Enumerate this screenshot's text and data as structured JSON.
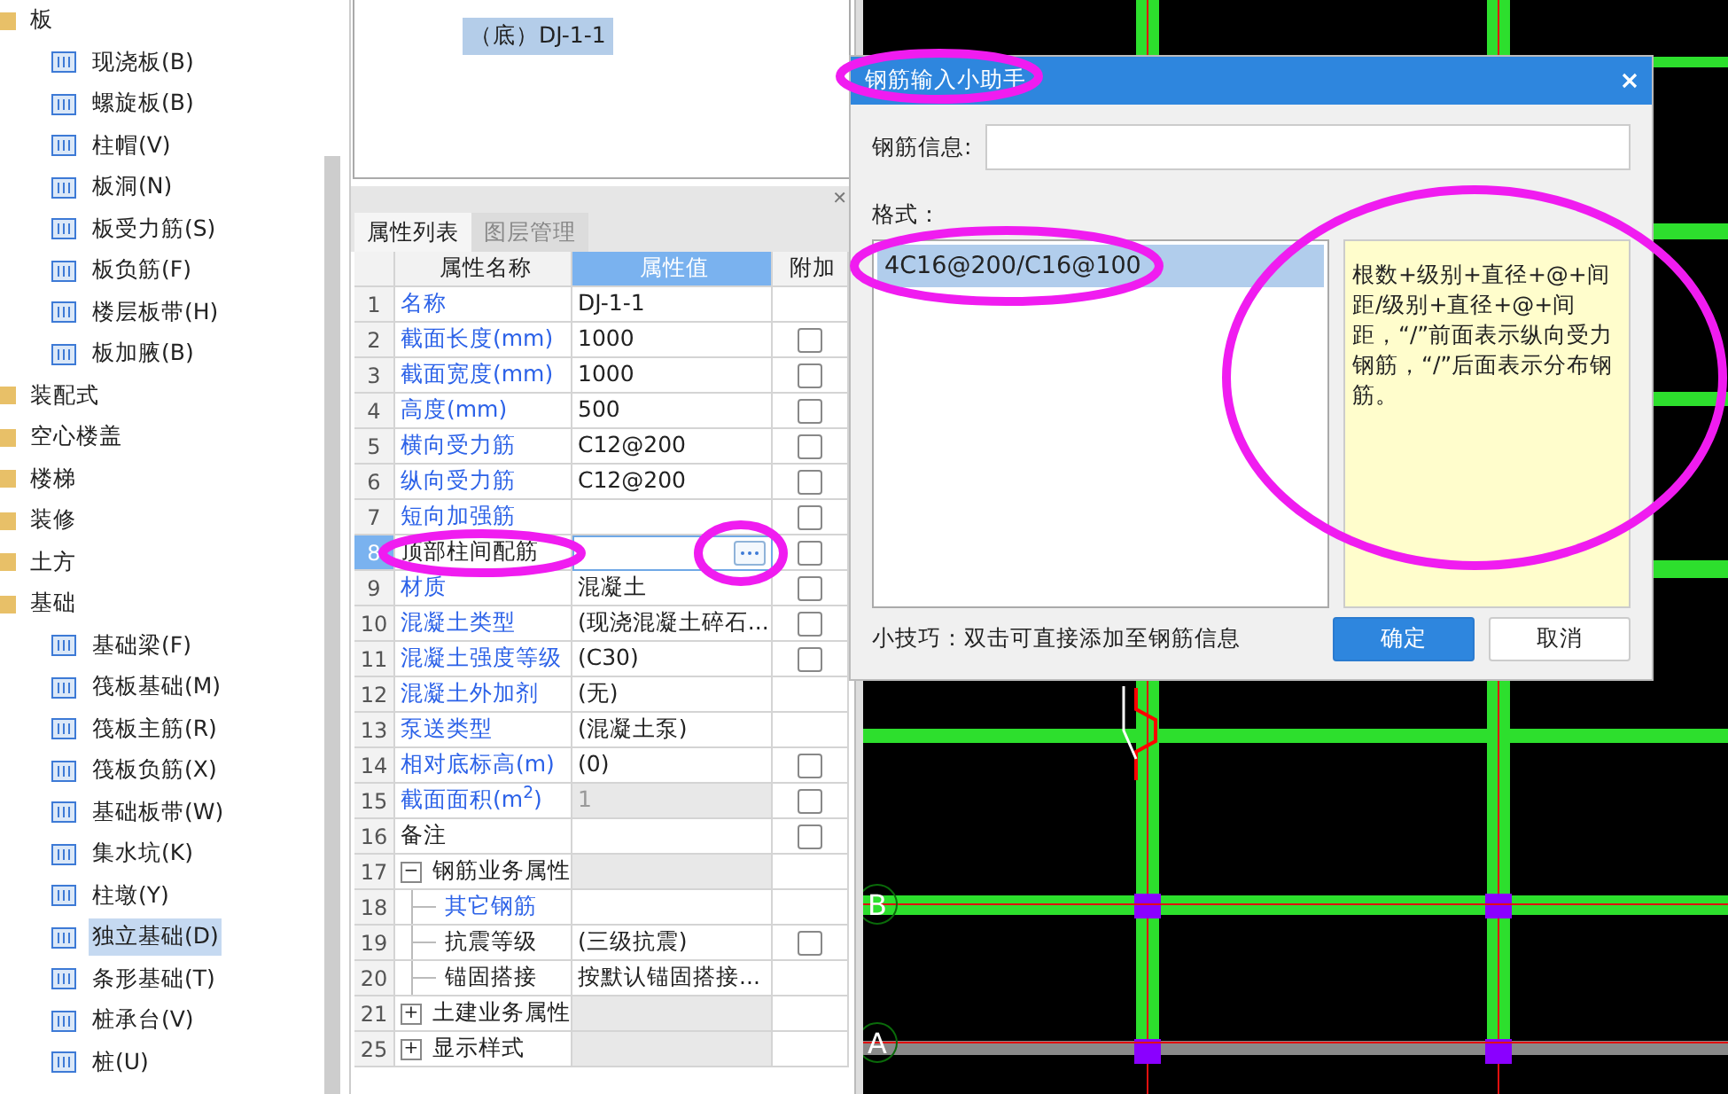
{
  "sidebar": {
    "items": [
      {
        "label": "板",
        "children": [
          {
            "label": "现浇板(B)",
            "selected": false
          },
          {
            "label": "螺旋板(B)",
            "selected": false
          },
          {
            "label": "柱帽(V)",
            "selected": false
          },
          {
            "label": "板洞(N)",
            "selected": false
          },
          {
            "label": "板受力筋(S)",
            "selected": false
          },
          {
            "label": "板负筋(F)",
            "selected": false
          },
          {
            "label": "楼层板带(H)",
            "selected": false
          },
          {
            "label": "板加腋(B)",
            "selected": false
          }
        ]
      },
      {
        "label": "装配式"
      },
      {
        "label": "空心楼盖"
      },
      {
        "label": "楼梯"
      },
      {
        "label": "装修"
      },
      {
        "label": "土方"
      },
      {
        "label": "基础",
        "children": [
          {
            "label": "基础梁(F)",
            "selected": false
          },
          {
            "label": "筏板基础(M)",
            "selected": false
          },
          {
            "label": "筏板主筋(R)",
            "selected": false
          },
          {
            "label": "筏板负筋(X)",
            "selected": false
          },
          {
            "label": "基础板带(W)",
            "selected": false
          },
          {
            "label": "集水坑(K)",
            "selected": false
          },
          {
            "label": "柱墩(Y)",
            "selected": false
          },
          {
            "label": "独立基础(D)",
            "selected": true
          },
          {
            "label": "条形基础(T)",
            "selected": false
          },
          {
            "label": "桩承台(V)",
            "selected": false
          },
          {
            "label": "桩(U)",
            "selected": false
          }
        ]
      }
    ]
  },
  "component_tree": {
    "items": [
      {
        "label": "（底）DJ-1-1",
        "selected": true
      }
    ]
  },
  "properties": {
    "tabs": [
      {
        "label": "属性列表",
        "selected": true
      },
      {
        "label": "图层管理",
        "selected": false
      }
    ],
    "columns": [
      {
        "label": "属性名称",
        "selected": false
      },
      {
        "label": "属性值",
        "selected": true
      },
      {
        "label": "附加",
        "selected": false
      }
    ],
    "rows": [
      {
        "num": "1",
        "kind": "public",
        "name": "名称",
        "value": "DJ-1-1",
        "selected": false
      },
      {
        "num": "2",
        "kind": "public",
        "name": "截面长度(mm)",
        "value": "1000",
        "selected": false,
        "checked": false
      },
      {
        "num": "3",
        "kind": "public",
        "name": "截面宽度(mm)",
        "value": "1000",
        "selected": false,
        "checked": false
      },
      {
        "num": "4",
        "kind": "public",
        "name": "高度(mm)",
        "value": "500",
        "selected": false,
        "checked": false
      },
      {
        "num": "5",
        "kind": "public",
        "name": "横向受力筋",
        "value": "C12@200",
        "selected": false,
        "checked": false
      },
      {
        "num": "6",
        "kind": "public",
        "name": "纵向受力筋",
        "value": "C12@200",
        "selected": false,
        "checked": false
      },
      {
        "num": "7",
        "kind": "public",
        "name": "短向加强筋",
        "selected": false,
        "checked": false
      },
      {
        "num": "8",
        "kind": "private",
        "name": "顶部柱间配筋",
        "selected": true,
        "editing": true,
        "checked": false
      },
      {
        "num": "9",
        "kind": "public",
        "name": "材质",
        "value": "混凝土",
        "selected": false,
        "checked": false
      },
      {
        "num": "10",
        "kind": "public",
        "name": "混凝土类型",
        "value": "(现浇混凝土碎石...",
        "selected": false,
        "checked": false
      },
      {
        "num": "11",
        "kind": "public",
        "name": "混凝土强度等级",
        "value": "(C30)",
        "selected": false,
        "checked": false
      },
      {
        "num": "12",
        "kind": "public",
        "name": "混凝土外加剂",
        "value": "(无)",
        "selected": false
      },
      {
        "num": "13",
        "kind": "public",
        "name": "泵送类型",
        "value": "(混凝土泵)",
        "selected": false
      },
      {
        "num": "14",
        "kind": "public",
        "name": "相对底标高(m)",
        "value": "(0)",
        "selected": false,
        "checked": false
      },
      {
        "num": "15",
        "kind": "public",
        "name": "截面面积(m$^{2}$)",
        "value": "1",
        "disabled": true,
        "selected": false,
        "checked": false
      },
      {
        "num": "16",
        "kind": "private",
        "name": "备注",
        "selected": false,
        "checked": false
      },
      {
        "num": "17",
        "kind": "group",
        "name": "钢筋业务属性",
        "toggle": "−",
        "selected": false,
        "children": [
          {
            "num": "18",
            "kind": "public",
            "name": "其它钢筋",
            "selected": false
          },
          {
            "num": "19",
            "kind": "private",
            "name": "抗震等级",
            "value": "(三级抗震)",
            "selected": false,
            "checked": false
          },
          {
            "num": "20",
            "kind": "private",
            "name": "锚固搭接",
            "value": "按默认锚固搭接...",
            "selected": false
          }
        ]
      },
      {
        "num": "21",
        "kind": "group",
        "name": "土建业务属性",
        "toggle": "+",
        "selected": false
      },
      {
        "num": "25",
        "kind": "group",
        "name": "显示样式",
        "toggle": "+",
        "selected": false
      }
    ],
    "close_glyph": "✕"
  },
  "dialog": {
    "title": "钢筋输入小助手",
    "info_label": "钢筋信息:",
    "format_label": "格式：",
    "formats": [
      {
        "label": "4C16@200/C16@100",
        "selected": true
      }
    ],
    "description": "根数+级别+直径+@+间距/级别+直径+@+间距，“/”前面表示纵向受力钢筋，“/”后面表示分布钢筋。",
    "tip": "小技巧：双击可直接添加至钢筋信息",
    "buttons": [
      {
        "label": "确定",
        "kind": "primary"
      },
      {
        "label": "取消",
        "kind": "secondary"
      }
    ]
  },
  "canvas": {
    "axes": [
      {
        "label": "B"
      },
      {
        "label": "A"
      }
    ]
  }
}
